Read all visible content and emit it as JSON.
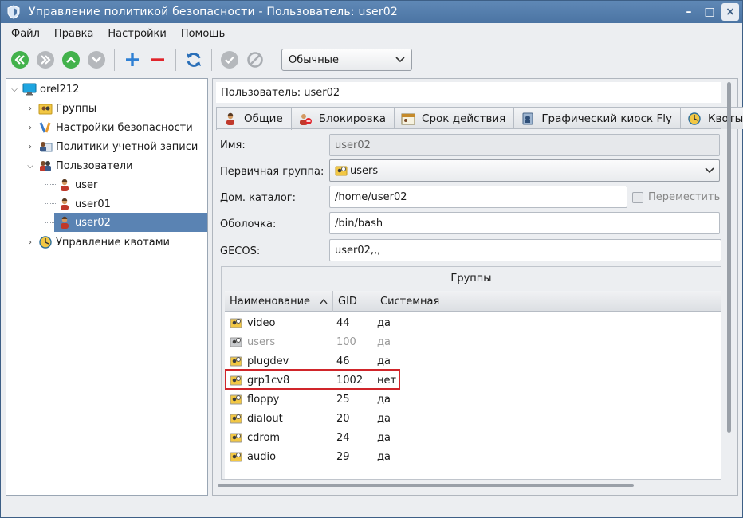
{
  "window": {
    "title": "Управление политикой безопасности - Пользователь: user02",
    "minimize": "–",
    "maximize": "□",
    "close": "×"
  },
  "menu": [
    "Файл",
    "Правка",
    "Настройки",
    "Помощь"
  ],
  "toolbar": {
    "mode_select": "Обычные",
    "icons": [
      "first-icon",
      "last-icon",
      "up-icon",
      "down-icon",
      "add-icon",
      "remove-icon",
      "refresh-icon",
      "apply-icon",
      "cancel-icon"
    ]
  },
  "tree": {
    "root": "orel212",
    "items": [
      {
        "label": "Группы"
      },
      {
        "label": "Настройки безопасности"
      },
      {
        "label": "Политики учетной записи"
      },
      {
        "label": "Пользователи"
      },
      {
        "label": "user"
      },
      {
        "label": "user01"
      },
      {
        "label": "user02"
      },
      {
        "label": "Управление квотами"
      }
    ]
  },
  "header": {
    "user_title": "Пользователь: user02"
  },
  "tabs": [
    {
      "label": "Общие"
    },
    {
      "label": "Блокировка"
    },
    {
      "label": "Срок действия"
    },
    {
      "label": "Графический киоск Fly"
    },
    {
      "label": "Квоты"
    }
  ],
  "form": {
    "name_label": "Имя:",
    "name_value": "user02",
    "group_label": "Первичная группа:",
    "group_value": "users",
    "home_label": "Дом. каталог:",
    "home_value": "/home/user02",
    "move_label": "Переместить",
    "shell_label": "Оболочка:",
    "shell_value": "/bin/bash",
    "gecos_label": "GECOS:",
    "gecos_value": "user02,,,"
  },
  "groups": {
    "title": "Группы",
    "columns": [
      "Наименование",
      "GID",
      "Системная"
    ],
    "rows": [
      {
        "name": "video",
        "gid": "44",
        "system": "да"
      },
      {
        "name": "users",
        "gid": "100",
        "system": "да"
      },
      {
        "name": "plugdev",
        "gid": "46",
        "system": "да"
      },
      {
        "name": "grp1cv8",
        "gid": "1002",
        "system": "нет"
      },
      {
        "name": "floppy",
        "gid": "25",
        "system": "да"
      },
      {
        "name": "dialout",
        "gid": "20",
        "system": "да"
      },
      {
        "name": "cdrom",
        "gid": "24",
        "system": "да"
      },
      {
        "name": "audio",
        "gid": "29",
        "system": "да"
      }
    ]
  },
  "colors": {
    "titlebar": "#4b74a3",
    "selection": "#5a83b3",
    "highlight": "#d0252a",
    "green": "#3fb24a",
    "blue": "#2f80d4",
    "red": "#e0242b"
  }
}
